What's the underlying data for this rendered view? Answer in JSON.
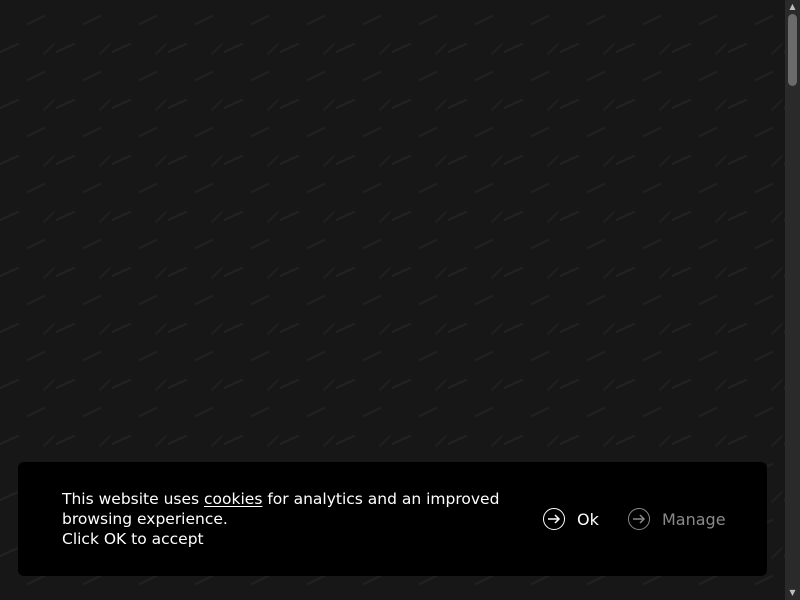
{
  "cookie_banner": {
    "text_before": "This website uses ",
    "link_text": "cookies",
    "text_after": " for analytics and an improved browsing experience.",
    "text_line2": "Click OK to accept",
    "ok_label": "Ok",
    "manage_label": "Manage",
    "ok_icon": "arrow-right-circle-icon",
    "manage_icon": "arrow-right-circle-icon"
  },
  "colors": {
    "page_background": "#171717",
    "rain_streak": "#222222",
    "banner_background": "#000000",
    "ok_color": "#ffffff",
    "manage_color": "#8a8a8a"
  }
}
